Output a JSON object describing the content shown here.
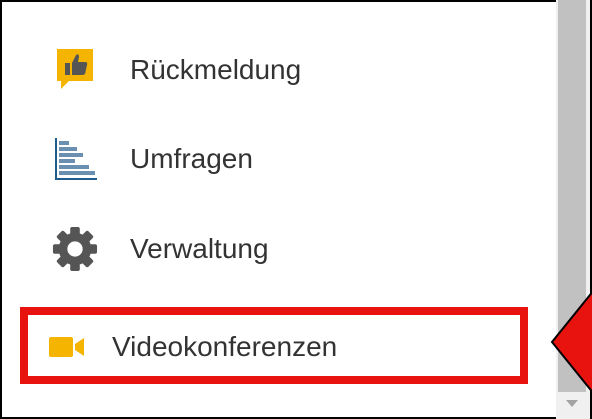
{
  "menu": {
    "items": [
      {
        "label": "Rückmeldung",
        "icon": "thumbs-up-feedback-icon"
      },
      {
        "label": "Umfragen",
        "icon": "bar-chart-icon"
      },
      {
        "label": "Verwaltung",
        "icon": "gear-icon"
      },
      {
        "label": "Videokonferenzen",
        "icon": "video-camera-icon"
      }
    ],
    "highlighted_index": 3
  },
  "colors": {
    "highlight": "#e8130f",
    "icon_yellow": "#f4b400",
    "icon_gray": "#555555",
    "icon_blue": "#1f5d8c"
  }
}
